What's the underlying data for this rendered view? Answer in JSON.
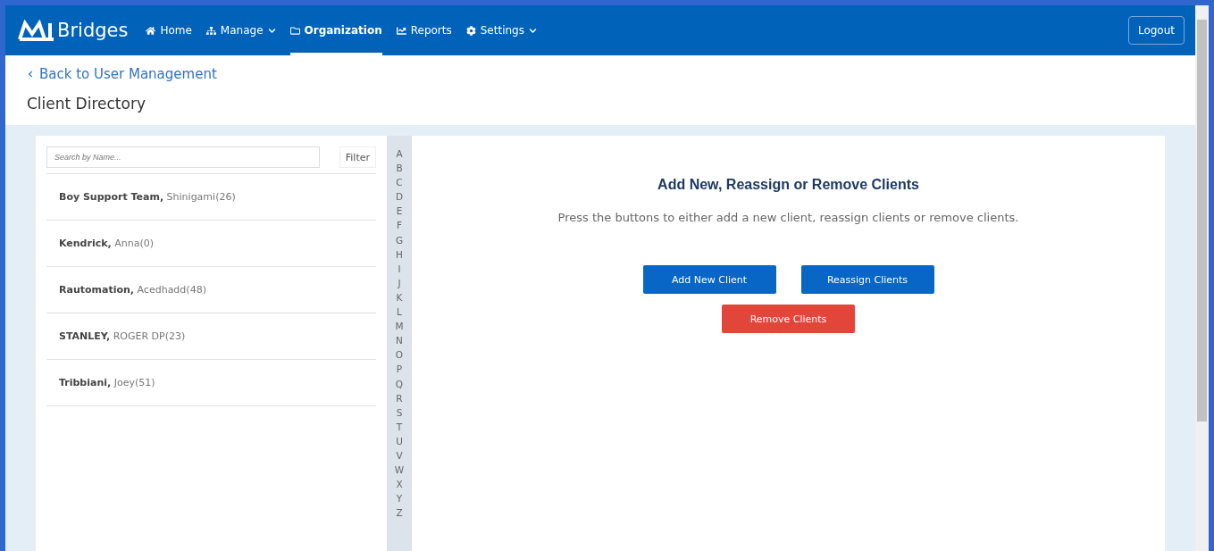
{
  "brand": {
    "name": "Bridges"
  },
  "nav": [
    {
      "label": "Home",
      "kind": "home",
      "selected": false,
      "dropdown": false
    },
    {
      "label": "Manage",
      "kind": "sitemap",
      "selected": false,
      "dropdown": true
    },
    {
      "label": "Organization",
      "kind": "folder",
      "selected": true,
      "dropdown": false
    },
    {
      "label": "Reports",
      "kind": "chart",
      "selected": false,
      "dropdown": false
    },
    {
      "label": "Settings",
      "kind": "gear",
      "selected": false,
      "dropdown": true
    }
  ],
  "logout": "Logout",
  "back_link": "Back to User Management",
  "page_title": "Client Directory",
  "search": {
    "placeholder": "Search by Name..."
  },
  "filter_button": "Filter",
  "clients": [
    {
      "last_name": "Boy Support Team,",
      "rest": "Shinigami(26)"
    },
    {
      "last_name": "Kendrick,",
      "rest": "Anna(0)"
    },
    {
      "last_name": "Rautomation,",
      "rest": "Acedhadd(48)"
    },
    {
      "last_name": "STANLEY,",
      "rest": "ROGER DP(23)"
    },
    {
      "last_name": "Tribbiani,",
      "rest": "Joey(51)"
    }
  ],
  "alphabet": [
    "A",
    "B",
    "C",
    "D",
    "E",
    "F",
    "G",
    "H",
    "I",
    "J",
    "K",
    "L",
    "M",
    "N",
    "O",
    "P",
    "Q",
    "R",
    "S",
    "T",
    "U",
    "V",
    "W",
    "X",
    "Y",
    "Z"
  ],
  "main": {
    "heading": "Add New, Reassign or Remove Clients",
    "description": "Press the buttons to either add a new client, reassign clients or remove clients.",
    "buttons": [
      {
        "label": "Add New Client",
        "kind": "primary"
      },
      {
        "label": "Reassign Clients",
        "kind": "primary"
      },
      {
        "label": "Remove Clients",
        "kind": "danger"
      }
    ]
  }
}
